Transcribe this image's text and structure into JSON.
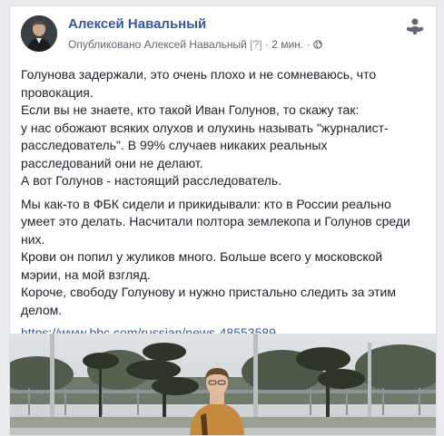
{
  "post": {
    "author": "Алексей Навальный",
    "meta_prefix": "Опубликовано Алексей Навальный",
    "meta_help": "[?]",
    "meta_time": "· 2 мин. ·",
    "paragraphs": [
      "Голунова задержали, это очень плохо и не сомневаюсь, что\nпровокация.\nЕсли вы не знаете, кто такой Иван Голунов, то скажу так:\nу нас обожают всяких олухов и олухинь называть \"журналист-\nрасследователь\". В 99% случаев никаких реальных\nрасследований они не делают.\nА вот Голунов - настоящий расследователь.",
      "Мы как-то в ФБК сидели и прикидывали: кто в России реально\nумеет это делать. Насчитали полтора землекопа и Голунов среди\nних.\nКрови он попил у жуликов много. Больше всего у московской\nмэрии, на мой взгляд.\nКороче, свободу Голунову и нужно пристально следить за этим\nделом."
    ],
    "link": "https://www.bbc.com/russian/news-48553589"
  },
  "icons": {
    "avatar": "author-avatar",
    "privacy": "globe-icon",
    "top_right": "people-settings-icon"
  },
  "colors": {
    "link": "#385898",
    "text": "#1d2129",
    "meta": "#616770"
  }
}
